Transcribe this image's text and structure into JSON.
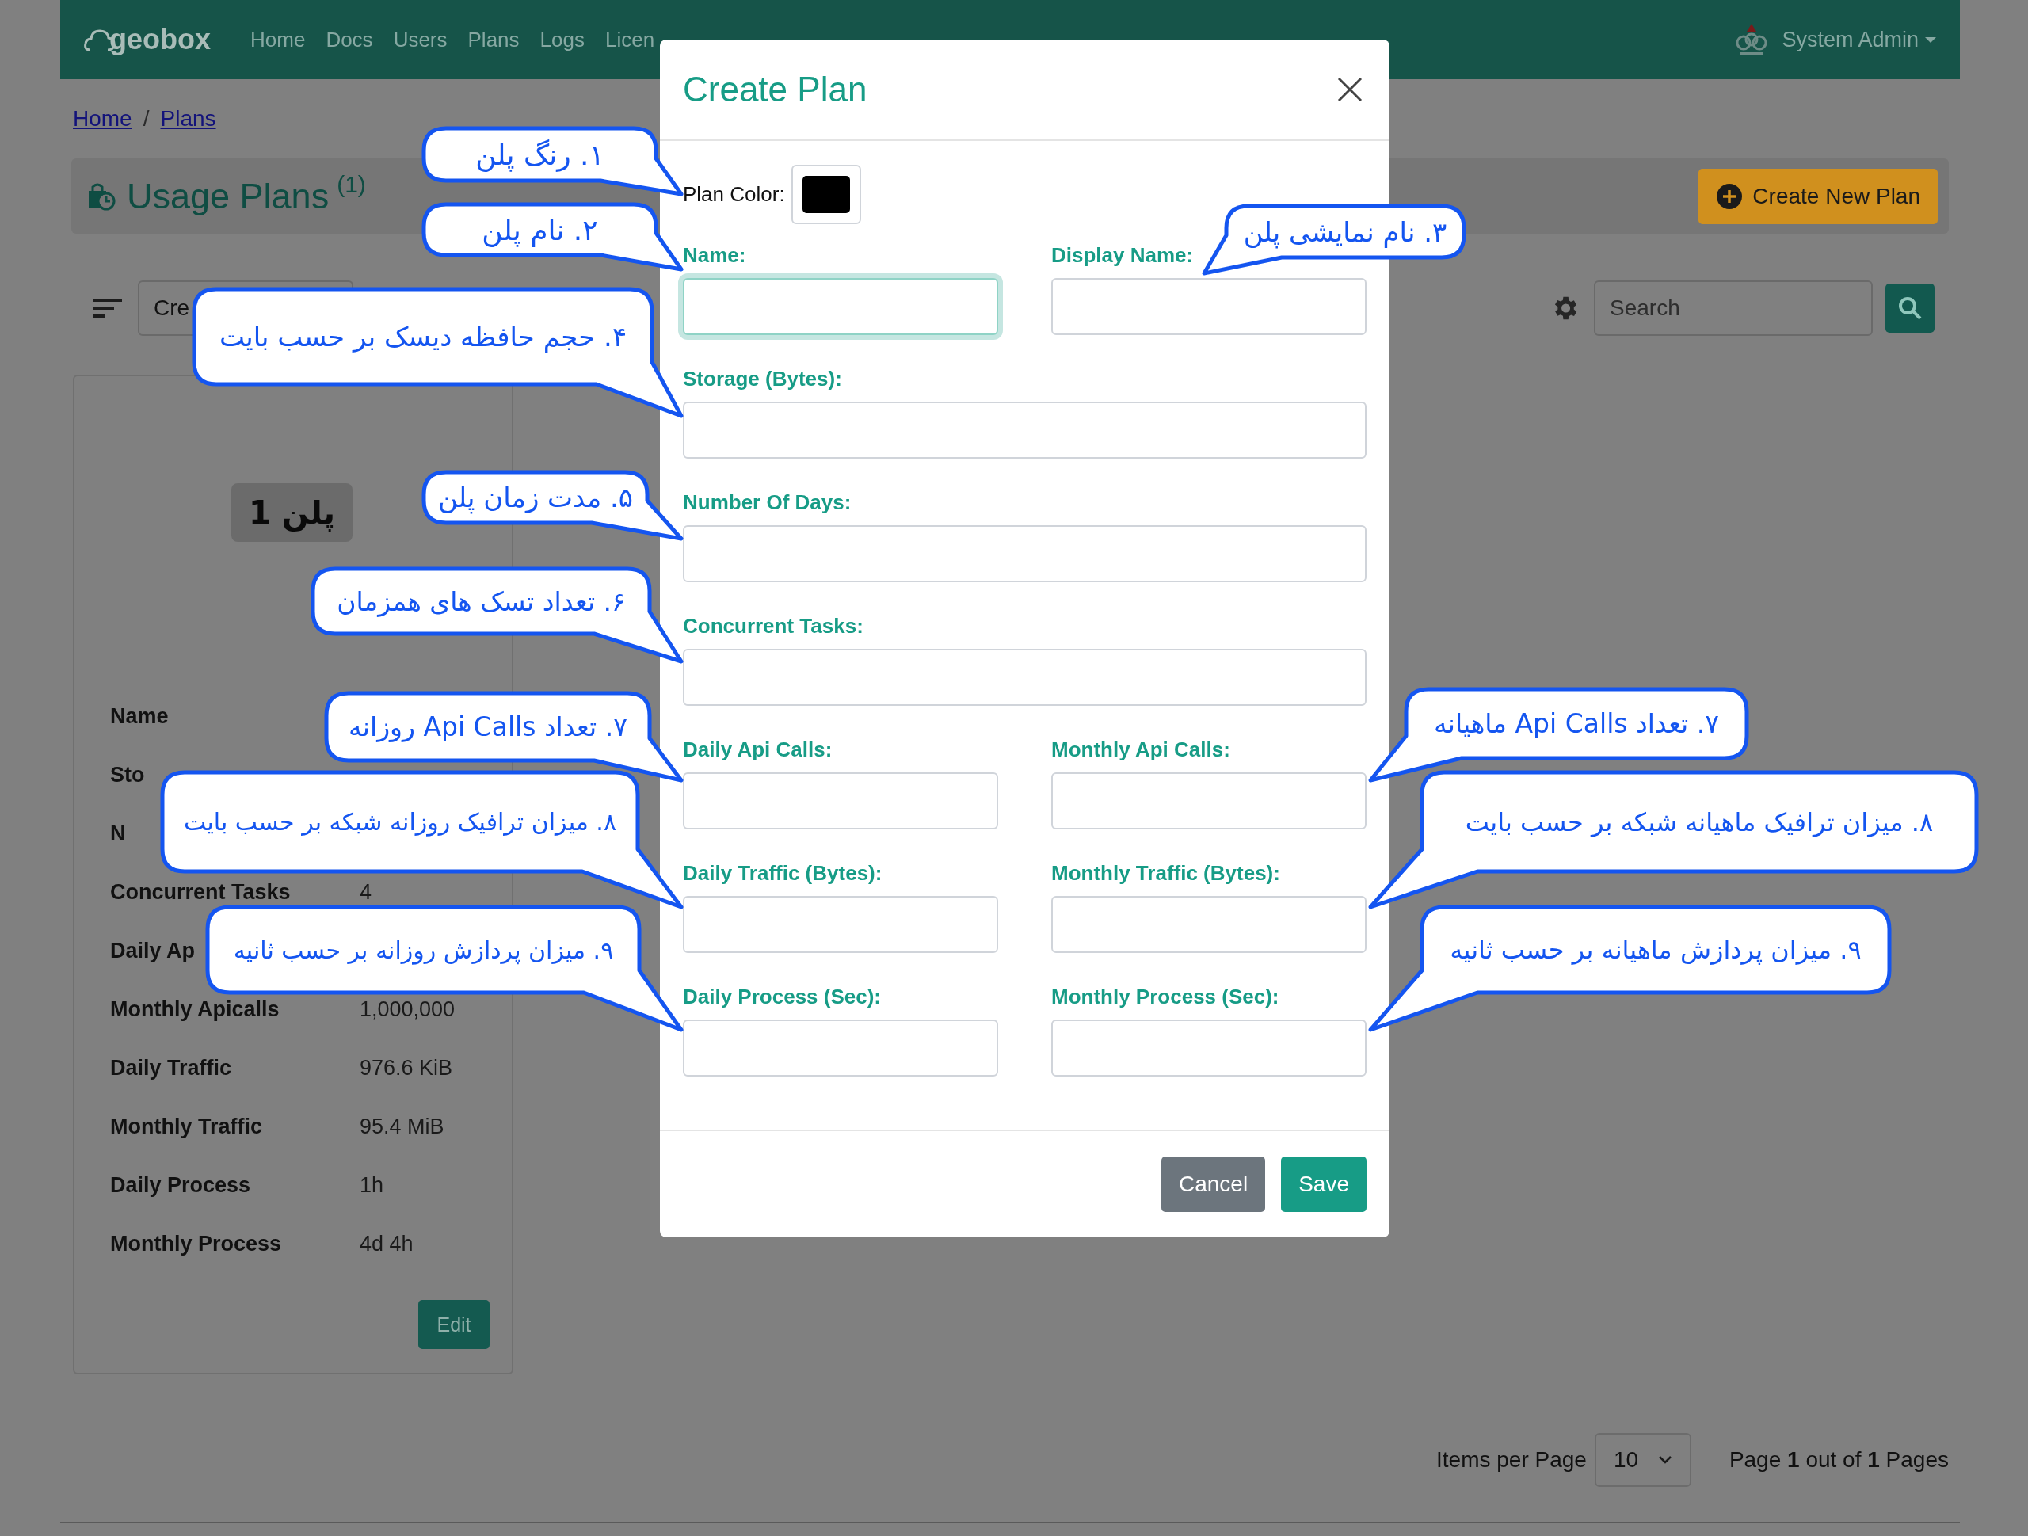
{
  "navbar": {
    "brand": "geobox",
    "links": [
      {
        "label": "Home"
      },
      {
        "label": "Docs"
      },
      {
        "label": "Users"
      },
      {
        "label": "Plans"
      },
      {
        "label": "Logs"
      },
      {
        "label": "Licen"
      }
    ],
    "user": "System Admin"
  },
  "breadcrumb": {
    "items": [
      "Home",
      "Plans"
    ],
    "separator": "/"
  },
  "header": {
    "title": "Usage Plans",
    "count": "(1)",
    "button": "Create New Plan"
  },
  "toolbar": {
    "sort_value": "Cre",
    "search_placeholder": "Search"
  },
  "plan_card": {
    "badge": "پلن 1",
    "rows": [
      {
        "label": "Name"
      },
      {
        "label": "Sto"
      },
      {
        "label": "N"
      },
      {
        "label": "Concurrent Tasks",
        "value": "4"
      },
      {
        "label": "Daily Ap"
      },
      {
        "label": "Monthly Apicalls",
        "value": "1,000,000"
      },
      {
        "label": "Daily Traffic",
        "value": "976.6 KiB"
      },
      {
        "label": "Monthly Traffic",
        "value": "95.4 MiB"
      },
      {
        "label": "Daily Process",
        "value": "1h"
      },
      {
        "label": "Monthly Process",
        "value": "4d 4h"
      }
    ],
    "edit": "Edit"
  },
  "pagination": {
    "items_label": "Items per Page",
    "per_page": "10",
    "page_text": "Page **1** out of **1** Pages"
  },
  "modal": {
    "title": "Create Plan",
    "color_label": "Plan Color:",
    "fields": [
      {
        "label": "Name:",
        "kind": "half",
        "focused": true
      },
      {
        "label": "Display Name:",
        "kind": "half",
        "focused": false
      },
      {
        "label": "Storage (Bytes):",
        "kind": "full",
        "focused": false
      },
      {
        "label": "Number Of Days:",
        "kind": "full",
        "focused": false
      },
      {
        "label": "Concurrent Tasks:",
        "kind": "full",
        "focused": false
      },
      {
        "label": "Daily Api Calls:",
        "kind": "half",
        "focused": false
      },
      {
        "label": "Monthly Api Calls:",
        "kind": "half",
        "focused": false
      },
      {
        "label": "Daily Traffic (Bytes):",
        "kind": "half",
        "focused": false
      },
      {
        "label": "Monthly Traffic (Bytes):",
        "kind": "half",
        "focused": false
      },
      {
        "label": "Daily Process (Sec):",
        "kind": "half",
        "focused": false
      },
      {
        "label": "Monthly Process (Sec):",
        "kind": "half",
        "focused": false
      }
    ],
    "buttons": [
      {
        "label": "Cancel",
        "kind": "secondary"
      },
      {
        "label": "Save",
        "kind": "primary"
      }
    ]
  },
  "callouts_left": [
    {
      "text": "۱. رنگ پلن"
    },
    {
      "text": "۲. نام پلن"
    },
    {
      "text": "۴. حجم حافظه دیسک بر حسب بایت"
    },
    {
      "text": "۵. مدت زمان پلن"
    },
    {
      "text": "۶. تعداد تسک های همزمان"
    },
    {
      "text": "۷. تعداد Api Calls روزانه"
    },
    {
      "text": "۸. میزان ترافیک روزانه شبکه بر حسب بایت"
    },
    {
      "text": "۹. میزان پردازش روزانه بر حسب ثانیه"
    }
  ],
  "callouts_right": [
    {
      "text": "۳. نام نمایشی پلن"
    },
    {
      "text": "۷. تعداد Api Calls ماهیانه"
    },
    {
      "text": "۸. میزان ترافیک ماهیانه شبکه بر حسب بایت"
    },
    {
      "text": "۹. میزان پردازش ماهیانه بر حسب ثانیه"
    }
  ]
}
